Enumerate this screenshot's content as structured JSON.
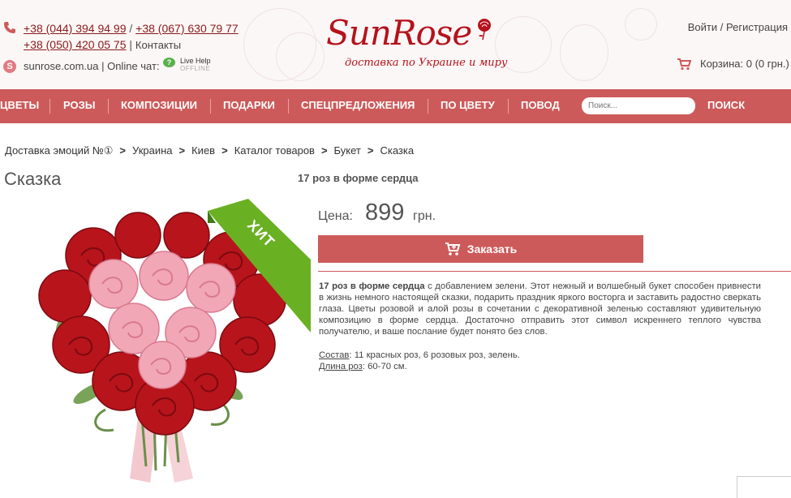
{
  "header": {
    "phone1": "+38 (044) 394 94 99",
    "phone_sep": " / ",
    "phone2": "+38 (067) 630 79 77",
    "phone3": "+38 (050) 420 05 75",
    "contacts_sep": " | ",
    "contacts": "Контакты",
    "site_line": "sunrose.com.ua | Online чат:",
    "live_help": "Live Help",
    "live_help_status": "OFFLINE",
    "logo_text": "SunRose",
    "logo_tagline": "доставка по Украине и миру",
    "login": "Войти",
    "account_sep": " / ",
    "register": "Регистрация",
    "cart": "Корзина: 0 (0 грн.)"
  },
  "nav": {
    "items": [
      "ЦВЕТЫ",
      "РОЗЫ",
      "КОМПОЗИЦИИ",
      "ПОДАРКИ",
      "СПЕЦПРЕДЛОЖЕНИЯ",
      "ПО ЦВЕТУ",
      "ПОВОД"
    ],
    "search_placeholder": "Поиск...",
    "search_button": "ПОИСК"
  },
  "breadcrumb": [
    "Доставка эмоций №①",
    "Украина",
    "Киев",
    "Каталог товаров",
    "Букет",
    "Сказка"
  ],
  "product": {
    "title": "Сказка",
    "subtitle": "17 роз в форме сердца",
    "badge": "ХИТ",
    "price_label": "Цена:",
    "price": "899",
    "currency": "грн.",
    "order_button": "Заказать",
    "desc_bold": "17 роз в форме сердца",
    "desc_text": " с добавлением зелени. Этот нежный и волшебный букет способен привнести в жизнь немного настоящей сказки, подарить праздник яркого восторга и заставить радостно сверкать глаза. Цветы розовой и алой розы в сочетании с декоративной зеленью составляют удивительную композицию в форме сердца. Достаточно отправить этот символ искреннего теплого чувства получателю, и ваше послание будет понято без слов.",
    "composition_label": "Состав",
    "composition_value": ": 11 красных роз, 6 розовых роз, зелень.",
    "length_label": "Длина роз",
    "length_value": ": 60-70 см."
  },
  "colors": {
    "accent": "#cd5a5a",
    "brand": "#b5121b",
    "badge": "#6ab023"
  }
}
